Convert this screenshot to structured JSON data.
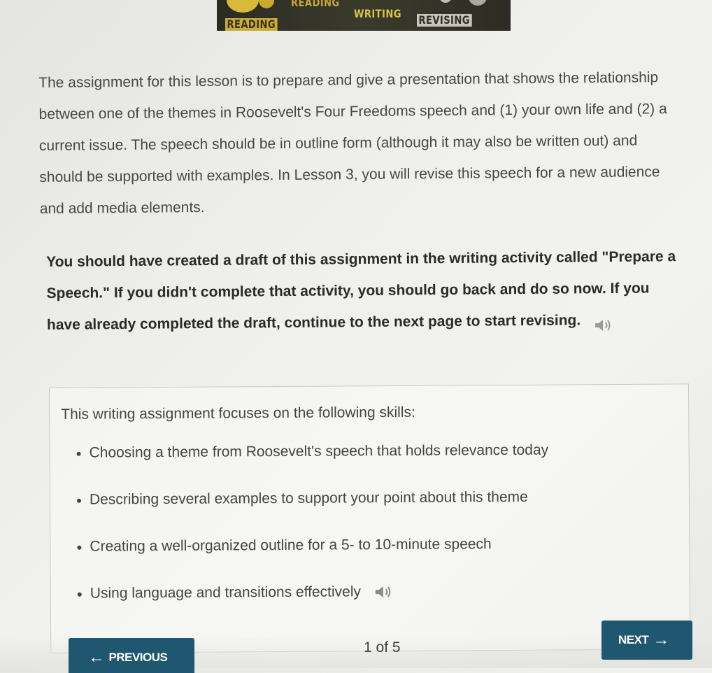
{
  "banner": {
    "reading_top": "READING",
    "reading": "READING",
    "writing": "WRITING",
    "revising": "REVISING"
  },
  "intro_paragraph": "The assignment for this lesson is to prepare and give a presentation that shows the relationship between one of the themes in Roosevelt's Four Freedoms speech and (1) your own life and (2) a current issue. The speech should be in outline form (although it may also be written out) and should be supported with examples. In Lesson 3, you will revise this speech for a new audience and add media elements.",
  "draft_paragraph": "You should have created a draft of this assignment in the writing activity called \"Prepare a Speech.\" If you didn't complete that activity, you should go back and do so now. If you have already completed the draft, continue to the next page to start revising.",
  "skills": {
    "title": "This writing assignment focuses on the following skills:",
    "items": [
      "Choosing a theme from Roosevelt's speech that holds relevance today",
      "Describing several examples to support your point about this theme",
      "Creating a well-organized outline for a 5- to 10-minute speech",
      "Using language and transitions effectively"
    ]
  },
  "navigation": {
    "previous_label": "PREVIOUS",
    "next_label": "NEXT",
    "page_indicator": "1 of 5"
  },
  "icons": {
    "speaker": "speaker-icon",
    "arrow_left": "arrow-left-icon",
    "arrow_right": "arrow-right-icon"
  },
  "colors": {
    "button": "#1f5670",
    "banner_dark": "#2b2b23",
    "banner_gold": "#c9ab3b"
  }
}
